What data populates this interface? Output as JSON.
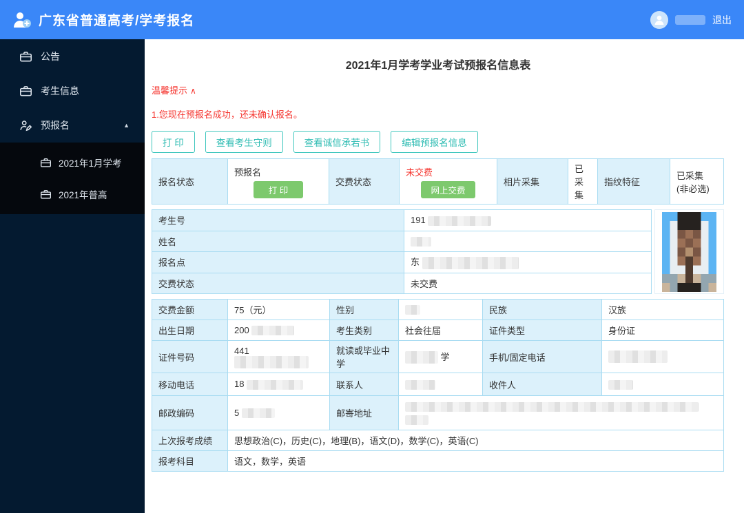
{
  "colors": {
    "blue": "#3a87f8",
    "navy": "#041a30",
    "submenu": "#05080d",
    "teal": "#2fbcb3",
    "green": "#7dc96d",
    "red": "#f5342e",
    "label_bg": "#dcf1fb",
    "border_blue": "#a9dcf2"
  },
  "header": {
    "title": "广东省普通高考/学考报名",
    "logout": "退出"
  },
  "sidebar": {
    "items": [
      {
        "label": "公告"
      },
      {
        "label": "考生信息"
      },
      {
        "label": "预报名"
      }
    ],
    "expand_caret": "▲",
    "subitems": [
      {
        "label": "2021年1月学考"
      },
      {
        "label": "2021年普高"
      }
    ]
  },
  "main": {
    "form_title": "2021年1月学考学业考试预报名信息表",
    "tips": {
      "label": "温馨提示",
      "chevron": "∧"
    },
    "notice": "1.您现在预报名成功，还未确认报名。",
    "toolbar": {
      "print": "打 印",
      "rules": "查看考生守则",
      "integrity": "查看诚信承若书",
      "edit": "编辑预报名信息"
    },
    "status": {
      "reg_label": "报名状态",
      "reg_value": "预报名",
      "reg_button": "打 印",
      "pay_label": "交费状态",
      "pay_value": "未交费",
      "pay_button": "网上交费",
      "photo_label": "相片采集",
      "photo_value": "已采集",
      "finger_label": "指纹特征",
      "finger_value": "已采集 (非必选)"
    },
    "identity": {
      "exam_no_label": "考生号",
      "exam_no_prefix": "191",
      "name_label": "姓名",
      "reg_point_label": "报名点",
      "reg_point_prefix": "东",
      "pay_label": "交费状态",
      "pay_value": "未交费"
    },
    "detail": {
      "fee_label": "交费金额",
      "fee_value": "75（元）",
      "gender_label": "性别",
      "ethnic_label": "民族",
      "ethnic_value": "汉族",
      "dob_label": "出生日期",
      "dob_prefix": "200",
      "category_label": "考生类别",
      "category_value": "社会往届",
      "idtype_label": "证件类型",
      "idtype_value": "身份证",
      "idno_label": "证件号码",
      "idno_prefix": "441",
      "school_label": "就读或毕业中学",
      "school_suffix": "学",
      "phone_label": "手机/固定电话",
      "mobile_label": "移动电话",
      "mobile_prefix": "18",
      "contact_label": "联系人",
      "recipient_label": "收件人",
      "zip_label": "邮政编码",
      "zip_prefix": "5",
      "address_label": "邮寄地址",
      "scores_label": "上次报考成绩",
      "scores_value": "思想政治(C)，历史(C)，地理(B)，语文(D)，数学(C)，英语(C)",
      "subjects_label": "报考科目",
      "subjects_value": "语文，数学，英语"
    }
  },
  "photo": {
    "palette": {
      "B": "#5cb4f3",
      "W": "#e8eef2",
      "H": "#26221f",
      "D": "#7a5644",
      "S": "#9b7056",
      "L": "#b3906f",
      "N": "#4e3a2e",
      "G": "#93a6b0",
      "T": "#c9b49b"
    },
    "grid": [
      "BBHHHBB",
      "BWHHHWB",
      "BWDSDWB",
      "BWSDSWB",
      "BWDLDWB",
      "BWSNSWB",
      "BWWNWWB",
      "GGTNTGG",
      "TGHHHGT"
    ]
  }
}
